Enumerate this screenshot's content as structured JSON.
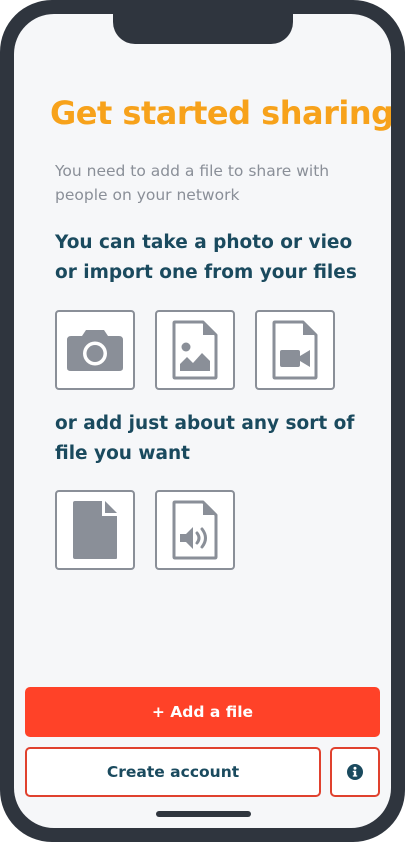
{
  "onboarding": {
    "title": "Get started sharing",
    "subtitle": "You need to add a file to share with people on your network",
    "media_heading": "You can take a photo or vieo or import one from your files",
    "other_heading": "or add just about any sort of file you want"
  },
  "media_options": [
    {
      "icon": "camera-icon"
    },
    {
      "icon": "image-file-icon"
    },
    {
      "icon": "video-file-icon"
    }
  ],
  "other_options": [
    {
      "icon": "document-icon"
    },
    {
      "icon": "audio-file-icon"
    }
  ],
  "actions": {
    "add_file_label": "+ Add a file",
    "create_account_label": "Create account",
    "info_icon": "info-icon"
  },
  "colors": {
    "accent_title": "#f7a21b",
    "heading": "#1a4a5e",
    "muted": "#8a8f98",
    "primary": "#ff4228",
    "border_accent": "#e0412e",
    "device_frame": "#2f353e"
  }
}
